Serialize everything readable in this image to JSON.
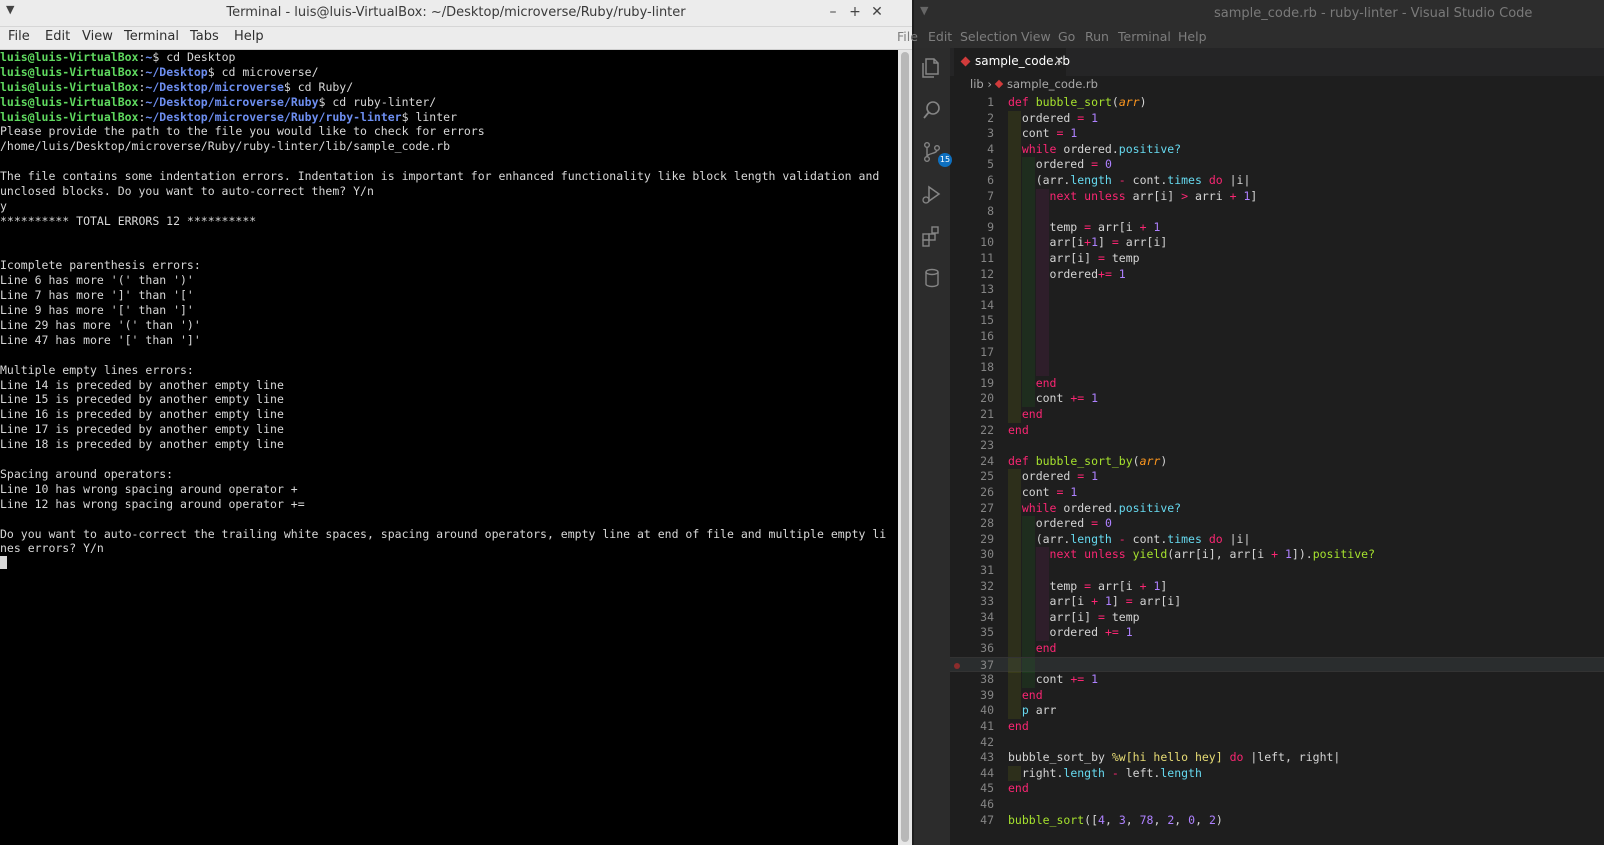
{
  "terminal": {
    "title": "Terminal - luis@luis-VirtualBox: ~/Desktop/microverse/Ruby/ruby-linter",
    "menu": [
      "File",
      "Edit",
      "View",
      "Terminal",
      "Tabs",
      "Help"
    ],
    "prompts": [
      {
        "user": "luis@luis-VirtualBox",
        "path": "~",
        "cmd": "cd Desktop"
      },
      {
        "user": "luis@luis-VirtualBox",
        "path": "~/Desktop",
        "cmd": "cd microverse/"
      },
      {
        "user": "luis@luis-VirtualBox",
        "path": "~/Desktop/microverse",
        "cmd": "cd Ruby/"
      },
      {
        "user": "luis@luis-VirtualBox",
        "path": "~/Desktop/microverse/Ruby",
        "cmd": "cd ruby-linter/"
      },
      {
        "user": "luis@luis-VirtualBox",
        "path": "~/Desktop/microverse/Ruby/ruby-linter",
        "cmd": "linter"
      }
    ],
    "output": [
      "Please provide the path to the file you would like to check for errors",
      "/home/luis/Desktop/microverse/Ruby/ruby-linter/lib/sample_code.rb",
      "",
      "The file contains some indentation errors. Indentation is important for enhanced functionality like block length validation and",
      "unclosed blocks. Do you want to auto-correct them? Y/n",
      "y",
      "********** TOTAL ERRORS 12 **********",
      "",
      "",
      "Icomplete parenthesis errors:",
      "Line 6 has more '(' than ')'",
      "Line 7 has more ']' than '['",
      "Line 9 has more '[' than ']'",
      "Line 29 has more '(' than ')'",
      "Line 47 has more '[' than ']'",
      "",
      "Multiple empty lines errors:",
      "Line 14 is preceded by another empty line",
      "Line 15 is preceded by another empty line",
      "Line 16 is preceded by another empty line",
      "Line 17 is preceded by another empty line",
      "Line 18 is preceded by another empty line",
      "",
      "Spacing around operators:",
      "Line 10 has wrong spacing around operator +",
      "Line 12 has wrong spacing around operator +=",
      "",
      "Do you want to auto-correct the trailing white spaces, spacing around operators, empty line at end of file and multiple empty li",
      "nes errors? Y/n"
    ]
  },
  "vscode": {
    "title": "sample_code.rb - ruby-linter - Visual Studio Code",
    "menu": [
      "File",
      "Edit",
      "Selection",
      "View",
      "Go",
      "Run",
      "Terminal",
      "Help"
    ],
    "scm_badge": "15",
    "tab_label": "sample_code.rb",
    "tab_close": "×",
    "breadcrumb": {
      "folder": "lib",
      "sep": "›",
      "file": "sample_code.rb"
    },
    "current_line": 37,
    "breakpoint_line": 37,
    "lines": [
      {
        "n": "1",
        "guides": 0,
        "tokens": [
          [
            "kw",
            "def "
          ],
          [
            "fn",
            "bubble_sort"
          ],
          [
            "",
            "("
          ],
          [
            "pa",
            "arr"
          ],
          [
            "",
            ")"
          ]
        ]
      },
      {
        "n": "2",
        "guides": 1,
        "tokens": [
          [
            "",
            "  ordered "
          ],
          [
            "op",
            "="
          ],
          [
            "nm",
            " 1"
          ]
        ]
      },
      {
        "n": "3",
        "guides": 1,
        "tokens": [
          [
            "",
            "  cont "
          ],
          [
            "op",
            "="
          ],
          [
            "nm",
            " 1"
          ]
        ]
      },
      {
        "n": "4",
        "guides": 1,
        "tokens": [
          [
            "kw",
            "  while"
          ],
          [
            "",
            " ordered."
          ],
          [
            "me",
            "positive?"
          ]
        ]
      },
      {
        "n": "5",
        "guides": 2,
        "tokens": [
          [
            "",
            "    ordered "
          ],
          [
            "op",
            "="
          ],
          [
            "nm",
            " 0"
          ]
        ]
      },
      {
        "n": "6",
        "guides": 2,
        "tokens": [
          [
            "",
            "    (arr."
          ],
          [
            "me",
            "length"
          ],
          [
            "op",
            " - "
          ],
          [
            "",
            "cont."
          ],
          [
            "me",
            "times"
          ],
          [
            "kw",
            " do"
          ],
          [
            "",
            " |i|"
          ]
        ]
      },
      {
        "n": "7",
        "guides": 3,
        "tokens": [
          [
            "kw",
            "      next unless"
          ],
          [
            "",
            " arr[i] "
          ],
          [
            "op",
            ">"
          ],
          [
            "",
            " arri "
          ],
          [
            "op",
            "+"
          ],
          [
            "nm",
            " 1"
          ],
          [
            "",
            "]"
          ]
        ]
      },
      {
        "n": "8",
        "guides": 3,
        "tokens": []
      },
      {
        "n": "9",
        "guides": 3,
        "tokens": [
          [
            "",
            "      temp "
          ],
          [
            "op",
            "="
          ],
          [
            "",
            " arr[i "
          ],
          [
            "op",
            "+"
          ],
          [
            "nm",
            " 1"
          ]
        ]
      },
      {
        "n": "10",
        "guides": 3,
        "tokens": [
          [
            "",
            "      arr[i"
          ],
          [
            "op",
            "+"
          ],
          [
            "nm",
            "1"
          ],
          [
            "",
            "] "
          ],
          [
            "op",
            "="
          ],
          [
            "",
            " arr[i]"
          ]
        ]
      },
      {
        "n": "11",
        "guides": 3,
        "tokens": [
          [
            "",
            "      arr[i] "
          ],
          [
            "op",
            "="
          ],
          [
            "",
            " temp"
          ]
        ]
      },
      {
        "n": "12",
        "guides": 3,
        "tokens": [
          [
            "",
            "      ordered"
          ],
          [
            "op",
            "+="
          ],
          [
            "nm",
            " 1"
          ]
        ]
      },
      {
        "n": "13",
        "guides": 3,
        "tokens": []
      },
      {
        "n": "14",
        "guides": 3,
        "tokens": []
      },
      {
        "n": "15",
        "guides": 3,
        "tokens": []
      },
      {
        "n": "16",
        "guides": 3,
        "tokens": []
      },
      {
        "n": "17",
        "guides": 3,
        "tokens": []
      },
      {
        "n": "18",
        "guides": 3,
        "tokens": []
      },
      {
        "n": "19",
        "guides": 2,
        "tokens": [
          [
            "kw",
            "    end"
          ]
        ]
      },
      {
        "n": "20",
        "guides": 2,
        "tokens": [
          [
            "",
            "    cont "
          ],
          [
            "op",
            "+="
          ],
          [
            "nm",
            " 1"
          ]
        ]
      },
      {
        "n": "21",
        "guides": 1,
        "tokens": [
          [
            "kw",
            "  end"
          ]
        ]
      },
      {
        "n": "22",
        "guides": 0,
        "tokens": [
          [
            "kw",
            "end"
          ]
        ]
      },
      {
        "n": "23",
        "guides": 0,
        "tokens": []
      },
      {
        "n": "24",
        "guides": 0,
        "tokens": [
          [
            "kw",
            "def "
          ],
          [
            "fn",
            "bubble_sort_by"
          ],
          [
            "",
            "("
          ],
          [
            "pa",
            "arr"
          ],
          [
            "",
            ")"
          ]
        ]
      },
      {
        "n": "25",
        "guides": 1,
        "tokens": [
          [
            "",
            "  ordered "
          ],
          [
            "op",
            "="
          ],
          [
            "nm",
            " 1"
          ]
        ]
      },
      {
        "n": "26",
        "guides": 1,
        "tokens": [
          [
            "",
            "  cont "
          ],
          [
            "op",
            "="
          ],
          [
            "nm",
            " 1"
          ]
        ]
      },
      {
        "n": "27",
        "guides": 1,
        "tokens": [
          [
            "kw",
            "  while"
          ],
          [
            "",
            " ordered."
          ],
          [
            "me",
            "positive?"
          ]
        ]
      },
      {
        "n": "28",
        "guides": 2,
        "tokens": [
          [
            "",
            "    ordered "
          ],
          [
            "op",
            "="
          ],
          [
            "nm",
            " 0"
          ]
        ]
      },
      {
        "n": "29",
        "guides": 2,
        "tokens": [
          [
            "",
            "    (arr."
          ],
          [
            "me",
            "length"
          ],
          [
            "op",
            " - "
          ],
          [
            "",
            "cont."
          ],
          [
            "me",
            "times"
          ],
          [
            "kw",
            " do"
          ],
          [
            "",
            " |i|"
          ]
        ]
      },
      {
        "n": "30",
        "guides": 3,
        "tokens": [
          [
            "kw",
            "      next unless"
          ],
          [
            "fn",
            " yield"
          ],
          [
            "",
            "(arr[i], arr[i "
          ],
          [
            "op",
            "+"
          ],
          [
            "nm",
            " 1"
          ],
          [
            "",
            "])."
          ],
          [
            "fn",
            "positive?"
          ]
        ]
      },
      {
        "n": "31",
        "guides": 3,
        "tokens": []
      },
      {
        "n": "32",
        "guides": 3,
        "tokens": [
          [
            "",
            "      temp "
          ],
          [
            "op",
            "="
          ],
          [
            "",
            " arr[i "
          ],
          [
            "op",
            "+"
          ],
          [
            "nm",
            " 1"
          ],
          [
            "",
            "]"
          ]
        ]
      },
      {
        "n": "33",
        "guides": 3,
        "tokens": [
          [
            "",
            "      arr[i "
          ],
          [
            "op",
            "+"
          ],
          [
            "nm",
            " 1"
          ],
          [
            "",
            "] "
          ],
          [
            "op",
            "="
          ],
          [
            "",
            " arr[i]"
          ]
        ]
      },
      {
        "n": "34",
        "guides": 3,
        "tokens": [
          [
            "",
            "      arr[i] "
          ],
          [
            "op",
            "="
          ],
          [
            "",
            " temp"
          ]
        ]
      },
      {
        "n": "35",
        "guides": 3,
        "tokens": [
          [
            "",
            "      ordered "
          ],
          [
            "op",
            "+="
          ],
          [
            "nm",
            " 1"
          ]
        ]
      },
      {
        "n": "36",
        "guides": 2,
        "tokens": [
          [
            "kw",
            "    end"
          ]
        ]
      },
      {
        "n": "37",
        "guides": 2,
        "tokens": []
      },
      {
        "n": "38",
        "guides": 2,
        "tokens": [
          [
            "",
            "    cont "
          ],
          [
            "op",
            "+="
          ],
          [
            "nm",
            " 1"
          ]
        ]
      },
      {
        "n": "39",
        "guides": 1,
        "tokens": [
          [
            "kw",
            "  end"
          ]
        ]
      },
      {
        "n": "40",
        "guides": 1,
        "tokens": [
          [
            "me",
            "  p"
          ],
          [
            "",
            " arr"
          ]
        ]
      },
      {
        "n": "41",
        "guides": 0,
        "tokens": [
          [
            "kw",
            "end"
          ]
        ]
      },
      {
        "n": "42",
        "guides": 0,
        "tokens": []
      },
      {
        "n": "43",
        "guides": 0,
        "tokens": [
          [
            "",
            "bubble_sort_by "
          ],
          [
            "st",
            "%w[hi hello hey]"
          ],
          [
            "kw",
            " do"
          ],
          [
            "",
            " |left, right|"
          ]
        ]
      },
      {
        "n": "44",
        "guides": 1,
        "tokens": [
          [
            "",
            "  right."
          ],
          [
            "me",
            "length"
          ],
          [
            "op",
            " - "
          ],
          [
            "",
            "left."
          ],
          [
            "me",
            "length"
          ]
        ]
      },
      {
        "n": "45",
        "guides": 0,
        "tokens": [
          [
            "kw",
            "end"
          ]
        ]
      },
      {
        "n": "46",
        "guides": 0,
        "tokens": []
      },
      {
        "n": "47",
        "guides": 0,
        "tokens": [
          [
            "fn",
            "bubble_sort"
          ],
          [
            "",
            "(["
          ],
          [
            "nm",
            "4"
          ],
          [
            "",
            ", "
          ],
          [
            "nm",
            "3"
          ],
          [
            "",
            ", "
          ],
          [
            "nm",
            "78"
          ],
          [
            "",
            ", "
          ],
          [
            "nm",
            "2"
          ],
          [
            "",
            ", "
          ],
          [
            "nm",
            "0"
          ],
          [
            "",
            ", "
          ],
          [
            "nm",
            "2"
          ],
          [
            "",
            ")"
          ]
        ]
      }
    ]
  }
}
